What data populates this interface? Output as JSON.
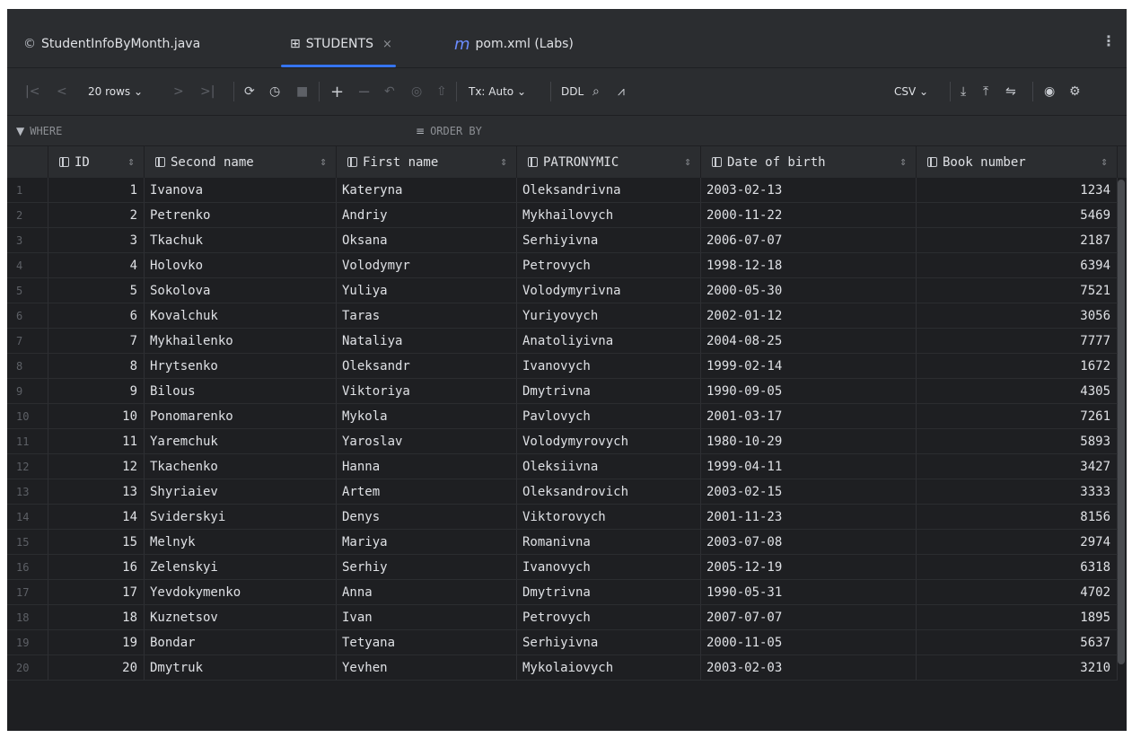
{
  "tabs": [
    {
      "icon": "©",
      "label": "StudentInfoByMonth.java"
    },
    {
      "icon": "⊞",
      "label": "STUDENTS",
      "close": "×"
    },
    {
      "icon": "m",
      "label": "pom.xml (Labs)"
    }
  ],
  "toolbar": {
    "rows_label": "20 rows ⌄",
    "tx_label": "Tx: Auto ⌄",
    "ddl_label": "DDL",
    "csv_label": "CSV ⌄"
  },
  "filter": {
    "where_label": "WHERE",
    "order_label": "ORDER BY"
  },
  "columns": [
    "ID",
    "Second name",
    "First name",
    "PATRONYMIC",
    "Date of birth",
    "Book number"
  ],
  "rows": [
    [
      "1",
      "Ivanova",
      "Kateryna",
      "Oleksandrivna",
      "2003-02-13",
      "1234"
    ],
    [
      "2",
      "Petrenko",
      "Andriy",
      "Mykhailovych",
      "2000-11-22",
      "5469"
    ],
    [
      "3",
      "Tkachuk",
      "Oksana",
      "Serhiyivna",
      "2006-07-07",
      "2187"
    ],
    [
      "4",
      "Holovko",
      "Volodymyr",
      "Petrovych",
      "1998-12-18",
      "6394"
    ],
    [
      "5",
      "Sokolova",
      "Yuliya",
      "Volodymyrivna",
      "2000-05-30",
      "7521"
    ],
    [
      "6",
      "Kovalchuk",
      "Taras",
      "Yuriyovych",
      "2002-01-12",
      "3056"
    ],
    [
      "7",
      "Mykhailenko",
      "Nataliya",
      "Anatoliyivna",
      "2004-08-25",
      "7777"
    ],
    [
      "8",
      "Hrytsenko",
      "Oleksandr",
      "Ivanovych",
      "1999-02-14",
      "1672"
    ],
    [
      "9",
      "Bilous",
      "Viktoriya",
      "Dmytrivna",
      "1990-09-05",
      "4305"
    ],
    [
      "10",
      "Ponomarenko",
      "Mykola",
      "Pavlovych",
      "2001-03-17",
      "7261"
    ],
    [
      "11",
      "Yaremchuk",
      "Yaroslav",
      "Volodymyrovych",
      "1980-10-29",
      "5893"
    ],
    [
      "12",
      "Tkachenko",
      "Hanna",
      "Oleksiivna",
      "1999-04-11",
      "3427"
    ],
    [
      "13",
      "Shyriaiev",
      "Artem",
      "Oleksandrovich",
      "2003-02-15",
      "3333"
    ],
    [
      "14",
      "Sviderskyi",
      "Denys",
      "Viktorovych",
      "2001-11-23",
      "8156"
    ],
    [
      "15",
      "Melnyk",
      "Mariya",
      "Romanivna",
      "2003-07-08",
      "2974"
    ],
    [
      "16",
      "Zelenskyi",
      "Serhiy",
      "Ivanovych",
      "2005-12-19",
      "6318"
    ],
    [
      "17",
      "Yevdokymenko",
      "Anna",
      "Dmytrivna",
      "1990-05-31",
      "4702"
    ],
    [
      "18",
      "Kuznetsov",
      "Ivan",
      "Petrovych",
      "2007-07-07",
      "1895"
    ],
    [
      "19",
      "Bondar",
      "Tetyana",
      "Serhiyivna",
      "2000-11-05",
      "5637"
    ],
    [
      "20",
      "Dmytruk",
      "Yevhen",
      "Mykolaiovych",
      "2003-02-03",
      "3210"
    ]
  ]
}
